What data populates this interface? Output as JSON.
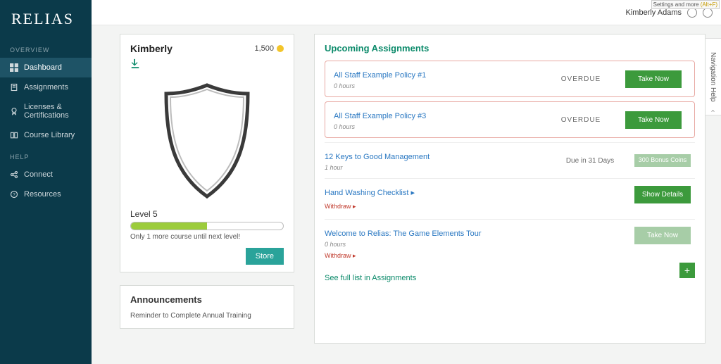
{
  "brand": "RELIAS",
  "topbar": {
    "settings_hint_pre": "Settings and more ",
    "settings_hint_alt": "(Alt+F)",
    "user_name": "Kimberly Adams"
  },
  "sidebar": {
    "overview_h": "OVERVIEW",
    "help_h": "HELP",
    "items_overview": [
      {
        "label": "Dashboard",
        "icon": "dashboard-icon",
        "active": true
      },
      {
        "label": "Assignments",
        "icon": "assignments-icon",
        "active": false
      },
      {
        "label": "Licenses & Certifications",
        "icon": "licenses-icon",
        "active": false
      },
      {
        "label": "Course Library",
        "icon": "library-icon",
        "active": false
      }
    ],
    "items_help": [
      {
        "label": "Connect",
        "icon": "share-icon"
      },
      {
        "label": "Resources",
        "icon": "help-icon"
      }
    ]
  },
  "profile": {
    "name": "Kimberly",
    "coin_count": "1,500",
    "level_label": "Level 5",
    "progress_msg": "Only 1 more course until next level!",
    "store_btn": "Store"
  },
  "announcements": {
    "heading": "Announcements",
    "items": [
      "Reminder to Complete Annual Training"
    ]
  },
  "upcoming": {
    "heading": "Upcoming Assignments",
    "full_list_link": "See full list in Assignments",
    "rows": [
      {
        "title": "All Staff Example Policy #1",
        "sub": "0 hours",
        "status": "OVERDUE",
        "action": "Take Now",
        "overdue": true
      },
      {
        "title": "All Staff Example Policy #3",
        "sub": "0 hours",
        "status": "OVERDUE",
        "action": "Take Now",
        "overdue": true
      },
      {
        "title": "12 Keys to Good Management",
        "sub": "1 hour",
        "due": "Due in 31 Days",
        "action": "300 Bonus Coins",
        "bonus": true
      },
      {
        "title": "Hand Washing Checklist ▸",
        "withdraw": "Withdraw ▸",
        "action": "Show Details"
      },
      {
        "title": "Welcome to Relias: The Game Elements Tour",
        "sub": "0 hours",
        "withdraw": "Withdraw ▸",
        "action": "Take Now",
        "muted": true
      }
    ]
  },
  "side_tab": {
    "label": "Navigation Help"
  }
}
